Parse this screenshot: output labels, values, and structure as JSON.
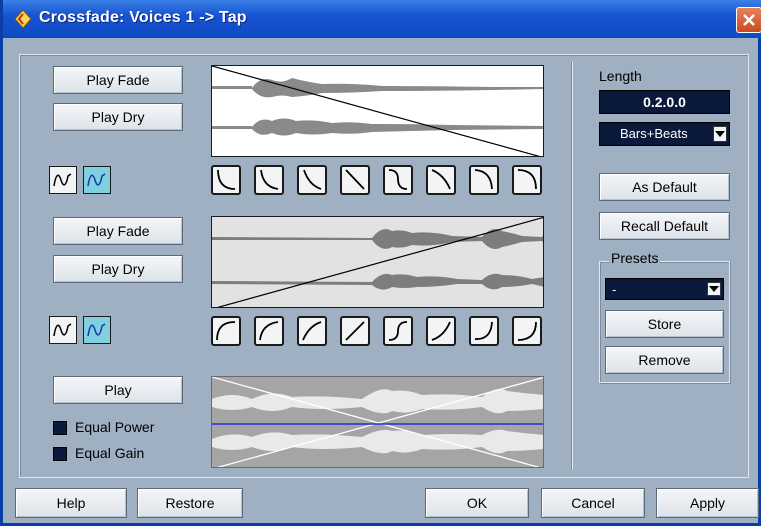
{
  "window": {
    "title": "Crossfade: Voices 1 -> Tap"
  },
  "fade_out": {
    "play_fade": "Play Fade",
    "play_dry": "Play Dry"
  },
  "fade_in": {
    "play_fade": "Play Fade",
    "play_dry": "Play Dry"
  },
  "crossfade": {
    "play": "Play",
    "equal_power": "Equal Power",
    "equal_gain": "Equal Gain",
    "equal_power_checked": false,
    "equal_gain_checked": false
  },
  "length": {
    "label": "Length",
    "value": "0.2.0.0",
    "format": "Bars+Beats"
  },
  "buttons": {
    "as_default": "As Default",
    "recall_default": "Recall Default",
    "store": "Store",
    "remove": "Remove",
    "help": "Help",
    "restore": "Restore",
    "ok": "OK",
    "cancel": "Cancel",
    "apply": "Apply"
  },
  "presets": {
    "label": "Presets",
    "value": "-"
  },
  "colors": {
    "title_bar": "#1754d2",
    "dialog_bg": "#9fb0c2",
    "lcd_bg": "#0b1a3a",
    "mode_active": "#7fd0e0",
    "crossfade_line": "#2b2bd6"
  },
  "icons": {
    "app": "cubase-logo-icon",
    "close": "close-icon",
    "dropdown": "chevron-down-icon"
  }
}
